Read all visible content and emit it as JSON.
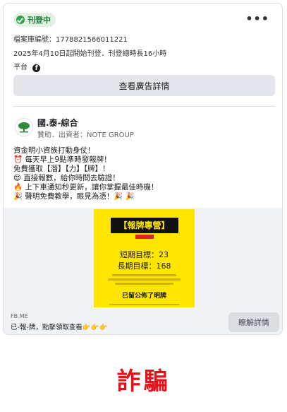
{
  "status": {
    "label": "刊登中",
    "color": "#31a24c"
  },
  "more_menu": "•••",
  "library_id": "檔案庫編號：1778821566011221",
  "run_info": "2025年4月10日起開始刊登．刊登總時長16小時",
  "platform_label": "平台",
  "platform_icon": "facebook-icon",
  "details_button": "查看廣告詳情",
  "advertiser": {
    "name": "國.泰-綜合",
    "sponsor": "贊助．出資者：NOTE GROUP"
  },
  "body_lines": [
    "資金明小資族打動身仗！",
    "⏰ 每天早上9點準時發報牌！",
    "免費獲取【潛】【力】【牌】！",
    "😍 直接報數，給你時間去驗證！",
    "🔥 上下車通知秒更新，讓你掌握最佳時機！",
    "🎉 聲明免費教學，眼見為憑！🎉 🎉"
  ],
  "poster": {
    "title": "【報牌專營】",
    "short_target": "短期目標：23",
    "long_target": "長期目標：168",
    "link_text": "已留公佈了明牌"
  },
  "footer": {
    "domain": "FB.ME",
    "description": "已-報-牌，點擊領取查看👉👉👉",
    "learn_more": "瞭解詳情"
  },
  "stamp": "詐騙"
}
